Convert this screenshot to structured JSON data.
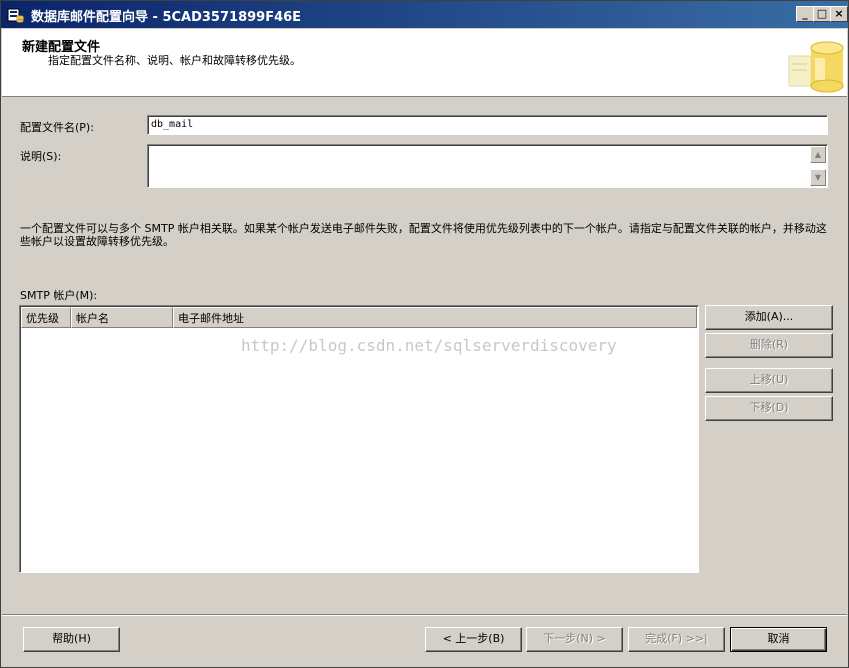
{
  "window": {
    "title": "数据库邮件配置向导 - 5CAD3571899F46E",
    "buttons": {
      "minimize": "_",
      "maximize": "□",
      "close": "×"
    }
  },
  "header": {
    "title": "新建配置文件",
    "subtitle": "指定配置文件名称、说明、帐户和故障转移优先级。"
  },
  "form": {
    "profile_name_label": "配置文件名(P):",
    "profile_name_value": "db_mail",
    "description_label": "说明(S):",
    "description_value": ""
  },
  "info_text": "一个配置文件可以与多个 SMTP 帐户相关联。如果某个帐户发送电子邮件失败，配置文件将使用优先级列表中的下一个帐户。请指定与配置文件关联的帐户，并移动这些帐户以设置故障转移优先级。",
  "smtp": {
    "label": "SMTP 帐户(M):",
    "columns": [
      "优先级",
      "帐户名",
      "电子邮件地址"
    ],
    "rows": []
  },
  "watermark": "http://blog.csdn.net/sqlserverdiscovery",
  "side_buttons": {
    "add": "添加(A)...",
    "remove": "删除(R)",
    "move_up": "上移(U)",
    "move_down": "下移(D)"
  },
  "footer": {
    "help": "帮助(H)",
    "back": "< 上一步(B)",
    "next": "下一步(N) >",
    "finish": "完成(F) >>|",
    "cancel": "取消"
  }
}
